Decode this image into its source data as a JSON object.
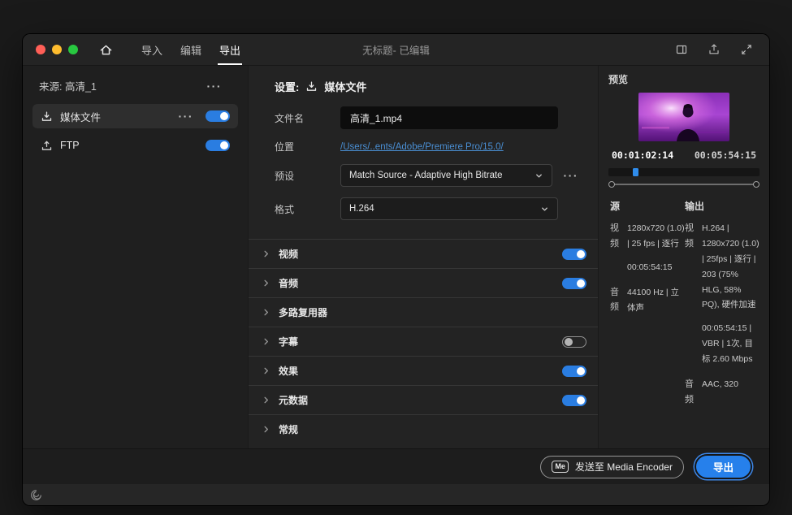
{
  "colors": {
    "accent-blue": "#2680eb",
    "toggle-on": "#2a7de1",
    "link-blue": "#4a8fd4",
    "traffic-red": "#ff5f57",
    "traffic-yellow": "#febc2e",
    "traffic-green": "#28c840"
  },
  "titlebar": {
    "title": "无标题- 已编辑",
    "tabs": [
      {
        "label": "导入"
      },
      {
        "label": "编辑"
      },
      {
        "label": "导出"
      }
    ]
  },
  "sidebar": {
    "source_label": "来源: 高清_1",
    "more": "···",
    "items": [
      {
        "label": "媒体文件",
        "more": "···",
        "toggle": "on"
      },
      {
        "label": "FTP",
        "toggle": "on"
      }
    ]
  },
  "settings": {
    "title": "设置:",
    "target": "媒体文件",
    "filename_label": "文件名",
    "filename_value": "高清_1.mp4",
    "location_label": "位置",
    "location_value": "/Users/..ents/Adobe/Premiere Pro/15.0/",
    "preset_label": "预设",
    "preset_value": "Match Source - Adaptive High Bitrate",
    "preset_more": "···",
    "format_label": "格式",
    "format_value": "H.264",
    "sections": [
      {
        "label": "视频",
        "toggle": "on"
      },
      {
        "label": "音频",
        "toggle": "on"
      },
      {
        "label": "多路复用器",
        "toggle": "none"
      },
      {
        "label": "字幕",
        "toggle": "off"
      },
      {
        "label": "效果",
        "toggle": "on"
      },
      {
        "label": "元数据",
        "toggle": "on"
      },
      {
        "label": "常规",
        "toggle": "none"
      }
    ]
  },
  "preview": {
    "label": "预览",
    "current_time": "00:01:02:14",
    "total_time": "00:05:54:15",
    "source_header": "源",
    "output_header": "输出",
    "source": {
      "video_label": "视频",
      "video_value": "1280x720 (1.0) | 25 fps | 逐行",
      "video_duration": "00:05:54:15",
      "audio_label": "音频",
      "audio_value": "44100 Hz | 立体声"
    },
    "output": {
      "video_label": "视频",
      "video_value": "H.264 | 1280x720 (1.0) | 25fps | 逐行 | 203 (75% HLG, 58% PQ), 硬件加速",
      "video_value2": "00:05:54:15 | VBR | 1次, 目标 2.60 Mbps",
      "audio_label": "音频",
      "audio_value": "AAC, 320"
    }
  },
  "footer": {
    "me_badge": "Me",
    "send_label": "发送至 Media Encoder",
    "export_label": "导出"
  }
}
